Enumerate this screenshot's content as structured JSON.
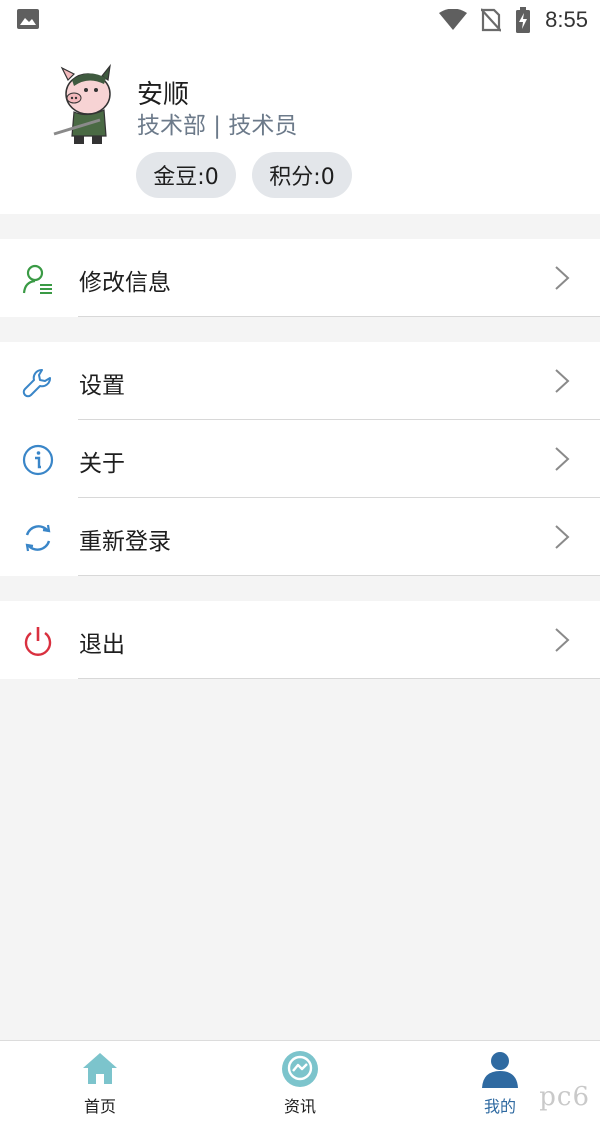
{
  "status_bar": {
    "time": "8:55"
  },
  "profile": {
    "name": "安顺",
    "department": "技术部 | 技术员",
    "beans_label": "金豆:0",
    "points_label": "积分:0"
  },
  "menu": {
    "edit_info": "修改信息",
    "settings": "设置",
    "about": "关于",
    "relogin": "重新登录",
    "logout": "退出"
  },
  "bottom_nav": {
    "home": "首页",
    "news": "资讯",
    "mine": "我的"
  },
  "watermark": "pc6",
  "colors": {
    "accent_blue": "#2f6aa1",
    "icon_green": "#3a9a45",
    "icon_blue": "#3a86c8",
    "icon_red": "#d9303f",
    "home_icon": "#7cc4cc",
    "pill_bg": "#e3e6ea"
  }
}
